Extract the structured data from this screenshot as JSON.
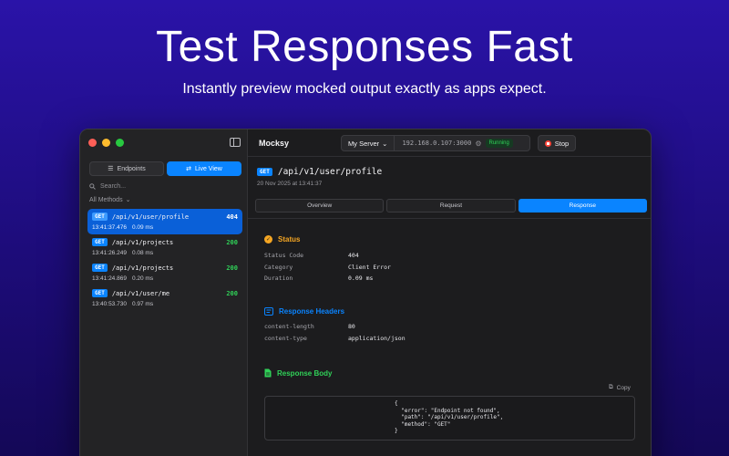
{
  "hero": {
    "title": "Test Responses Fast",
    "subtitle": "Instantly preview mocked output exactly as apps expect."
  },
  "sidebar": {
    "segments": [
      {
        "label": "Endpoints",
        "icon": "list-icon",
        "active": false
      },
      {
        "label": "Live View",
        "icon": "arrows-exchange-icon",
        "active": true
      }
    ],
    "search_placeholder": "Search...",
    "filter_label": "All Methods",
    "requests": [
      {
        "method": "GET",
        "path": "/api/v1/user/profile",
        "status": "404",
        "time": "13:41:37.476",
        "duration": "0.09 ms",
        "selected": true
      },
      {
        "method": "GET",
        "path": "/api/v1/projects",
        "status": "200",
        "time": "13:41:26.249",
        "duration": "0.08 ms",
        "selected": false
      },
      {
        "method": "GET",
        "path": "/api/v1/projects",
        "status": "200",
        "time": "13:41:24.869",
        "duration": "0.20 ms",
        "selected": false
      },
      {
        "method": "GET",
        "path": "/api/v1/user/me",
        "status": "200",
        "time": "13:40:53.730",
        "duration": "0.97 ms",
        "selected": false
      }
    ]
  },
  "toolbar": {
    "app_name": "Mocksy",
    "server_name": "My Server",
    "server_address": "192.168.0.107:3000",
    "server_status": "Running",
    "stop_label": "Stop"
  },
  "detail": {
    "method": "GET",
    "path": "/api/v1/user/profile",
    "date": "20 Nov 2025 at 13:41:37",
    "tabs": [
      "Overview",
      "Request",
      "Response"
    ],
    "active_tab": "Response",
    "status_section": {
      "title": "Status",
      "rows": [
        {
          "key": "Status Code",
          "value": "404"
        },
        {
          "key": "Category",
          "value": "Client Error"
        },
        {
          "key": "Duration",
          "value": "0.09 ms"
        }
      ]
    },
    "headers_section": {
      "title": "Response Headers",
      "rows": [
        {
          "key": "content-length",
          "value": "80"
        },
        {
          "key": "content-type",
          "value": "application/json"
        }
      ]
    },
    "body_section": {
      "title": "Response Body",
      "copy_label": "Copy",
      "code": "{\n  \"error\": \"Endpoint not found\",\n  \"path\": \"/api/v1/user/profile\",\n  \"method\": \"GET\"\n}"
    }
  },
  "colors": {
    "accent": "#0a84ff",
    "success": "#30d158",
    "status_icon": "#f5a623",
    "headers_icon": "#0a84ff",
    "body_icon": "#30d158"
  }
}
